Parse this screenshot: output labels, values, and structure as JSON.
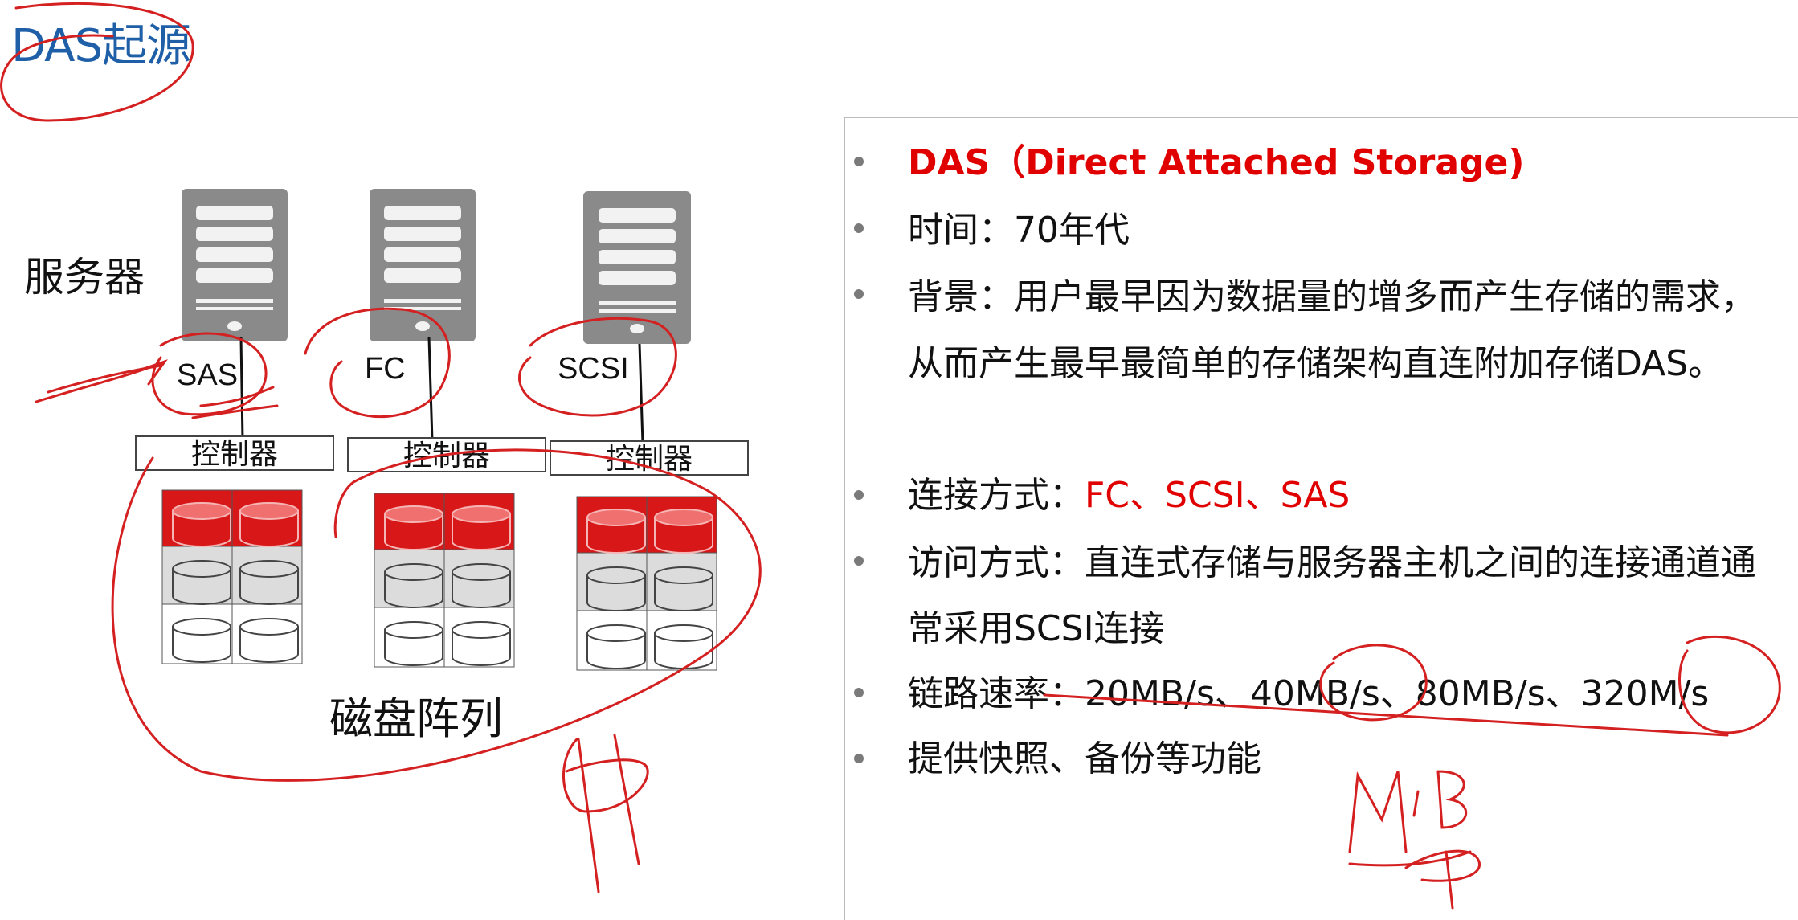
{
  "title": "DAS起源",
  "diagram": {
    "server_label": "服务器",
    "protocols": [
      "SAS",
      "FC",
      "SCSI"
    ],
    "controller_label": "控制器",
    "array_label": "磁盘阵列"
  },
  "panel": {
    "bullets": [
      {
        "prefix": "",
        "text": "DAS（Direct Attached Storage)"
      },
      {
        "prefix": "时间：",
        "text": "70年代"
      },
      {
        "prefix": "背景：",
        "text": "用户最早因为数据量的增多而产生存储的需求，"
      },
      {
        "prefix": "",
        "text": "从而产生最早最简单的存储架构直连附加存储DAS。"
      },
      {
        "prefix": "连接方式：",
        "text": "FC、SCSI、SAS"
      },
      {
        "prefix": "访问方式：",
        "text": "直连式存储与服务器主机之间的连接通道通"
      },
      {
        "prefix": "",
        "text": "常采用SCSI连接"
      },
      {
        "prefix": "链路速率：",
        "text": "20MB/s、40MB/s、80MB/s、320M/s"
      },
      {
        "prefix": "",
        "text": "提供快照、备份等功能"
      }
    ]
  },
  "colors": {
    "title": "#1f5fa8",
    "highlight": "#e00000",
    "annotation": "#d42020",
    "server": "#8a8a8a",
    "disk_red": "#d81818"
  }
}
